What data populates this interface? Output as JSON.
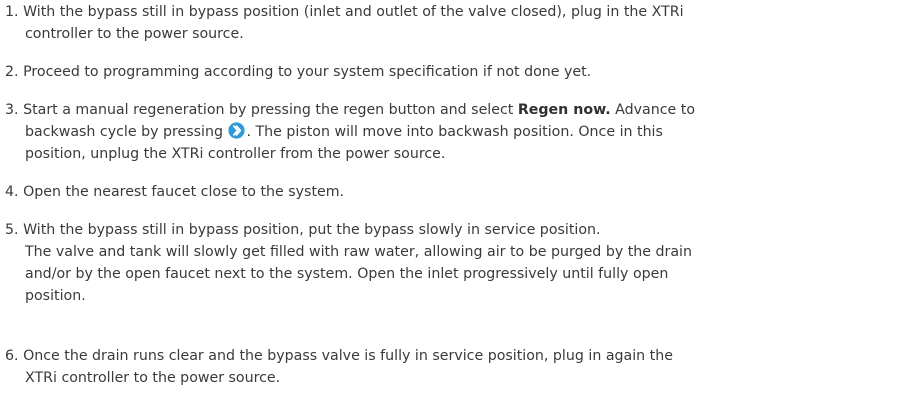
{
  "steps": [
    {
      "number": "1.",
      "lines": [
        "With the bypass still in bypass position (inlet and outlet of the valve closed), plug in the XTRi",
        "controller to the power source."
      ]
    },
    {
      "number": "2.",
      "lines": [
        "Proceed to programming according to your system specification if not done yet."
      ]
    },
    {
      "number": "3.",
      "line1_before_bold": "Start a manual regeneration by pressing the regen button and select ",
      "line1_bold": "Regen now.",
      "line1_after_bold": " Advance to",
      "line2_before_icon": "backwash cycle by pressing ",
      "line2_after_icon": ". The piston will move into backwash position. Once in this",
      "line3": "position, unplug the XTRi controller from the power source.",
      "icon": "advance-arrow-icon",
      "icon_color": "#2f9ad8"
    },
    {
      "number": "4.",
      "lines": [
        "Open the nearest faucet close to the system."
      ]
    },
    {
      "number": "5.",
      "lines": [
        "With the bypass still in bypass position, put the bypass slowly in service position.",
        "The valve and tank will slowly get filled with raw water, allowing air to be purged by the drain",
        "and/or by the open faucet next to the system. Open the inlet progressively until fully open",
        "position."
      ]
    },
    {
      "number": "6.",
      "lines": [
        "Once the drain runs clear and the bypass valve is fully in service position, plug in again the",
        "XTRi controller to the power source."
      ]
    }
  ]
}
